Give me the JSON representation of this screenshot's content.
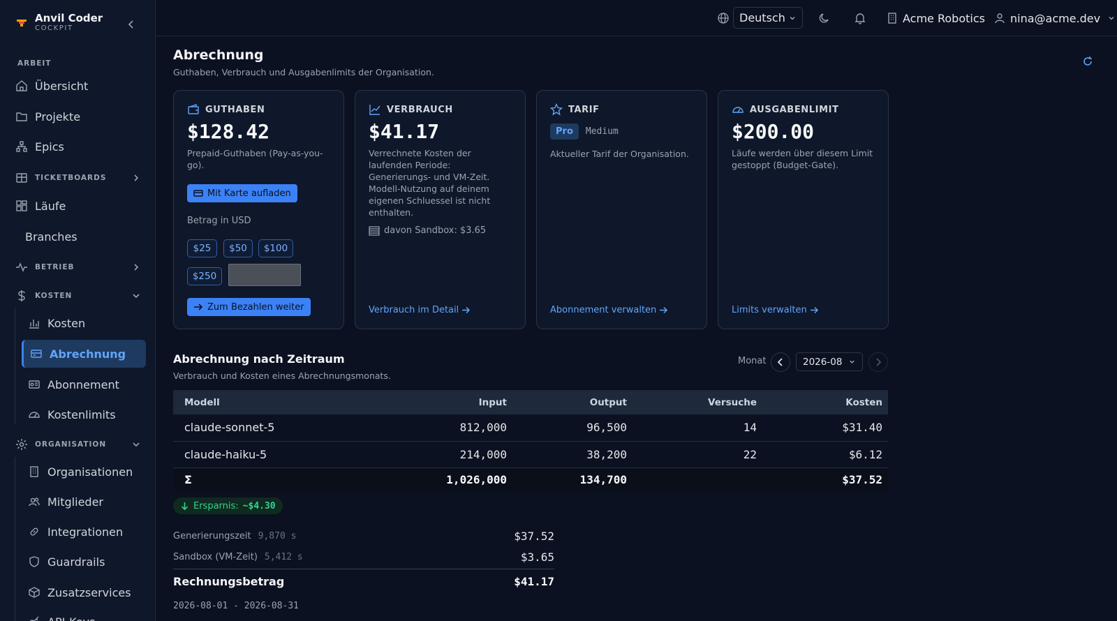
{
  "sidebar": {
    "brand_name": "Anvil Coder",
    "brand_tag": "COCKPIT",
    "section_work": "ARBEIT",
    "items": {
      "overview": "Übersicht",
      "projects": "Projekte",
      "epics": "Epics",
      "ticketboards": "TICKETBOARDS",
      "runs": "Läufe",
      "branches": "Branches",
      "operations": "BETRIEB",
      "costs_group": "KOSTEN",
      "costs": "Kosten",
      "billing": "Abrechnung",
      "subscription": "Abonnement",
      "cost_limits": "Kostenlimits",
      "organisation_group": "ORGANISATION",
      "organisations": "Organisationen",
      "members": "Mitglieder",
      "integrations": "Integrationen",
      "guardrails": "Guardrails",
      "add_on_services": "Zusatzservices",
      "api_keys": "API-Keys"
    }
  },
  "topbar": {
    "language": "Deutsch",
    "organisation": "Acme Robotics",
    "user": "nina@acme.dev"
  },
  "page": {
    "title": "Abrechnung",
    "subtitle": "Guthaben, Verbrauch und Ausgabenlimits der Organisation."
  },
  "cards": {
    "balance": {
      "label": "GUTHABEN",
      "amount": "$128.42",
      "description": "Prepaid-Guthaben (Pay-as-you-go).",
      "topup_button": "Mit Karte aufladen",
      "amount_label": "Betrag in USD",
      "presets": [
        "$25",
        "$50",
        "$100",
        "$250"
      ],
      "custom_amount_value": "",
      "checkout_button": "Zum Bezahlen weiter"
    },
    "usage": {
      "label": "VERBRAUCH",
      "amount": "$41.17",
      "description": "Verrechnete Kosten der laufenden Periode: Generierungs- und VM-Zeit. Modell-Nutzung auf deinem eigenen Schluessel ist nicht enthalten.",
      "sandbox_note": "davon Sandbox: $3.65",
      "link": "Verbrauch im Detail"
    },
    "plan": {
      "label": "TARIF",
      "plan_name": "Pro",
      "tier": "Medium",
      "description": "Aktueller Tarif der Organisation.",
      "link": "Abonnement verwalten"
    },
    "limit": {
      "label": "AUSGABENLIMIT",
      "amount": "$200.00",
      "description": "Läufe werden über diesem Limit gestoppt (Budget-Gate).",
      "link": "Limits verwalten"
    }
  },
  "period_section": {
    "title": "Abrechnung nach Zeitraum",
    "subtitle": "Verbrauch und Kosten eines Abrechnungsmonats.",
    "month_label": "Monat",
    "month_value": "2026-08",
    "table": {
      "headers": [
        "Modell",
        "Input",
        "Output",
        "Versuche",
        "Kosten"
      ],
      "rows": [
        [
          "claude-sonnet-5",
          "812,000",
          "96,500",
          "14",
          "$31.40"
        ],
        [
          "claude-haiku-5",
          "214,000",
          "38,200",
          "22",
          "$6.12"
        ]
      ],
      "sum_row": [
        "Σ",
        "1,026,000",
        "134,700",
        "",
        "$37.52"
      ]
    },
    "savings_label": "Ersparnis:",
    "savings_value": "~$4.30",
    "lines": [
      {
        "label": "Generierungszeit",
        "seconds": "9,870 s",
        "amount": "$37.52"
      },
      {
        "label": "Sandbox (VM-Zeit)",
        "seconds": "5,412 s",
        "amount": "$3.65"
      }
    ],
    "total_label": "Rechnungsbetrag",
    "total_amount": "$41.17",
    "period_range": "2026-08-01 - 2026-08-31"
  },
  "colors": {
    "accent": "#3b82f6",
    "background": "#0b1120",
    "sidebar": "#0f172a",
    "savings": "#34d399"
  }
}
